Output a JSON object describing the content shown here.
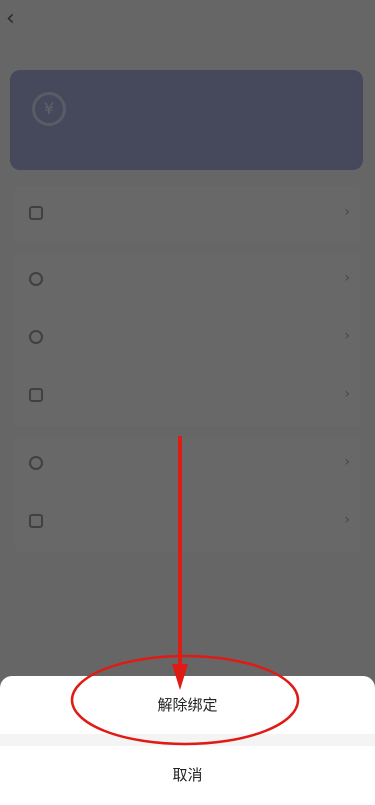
{
  "page": {
    "nav": {
      "back_icon": "chevron-left-icon",
      "title": "",
      "help": ""
    },
    "card": {
      "text": ""
    },
    "groups": [
      {
        "rows": [
          {
            "icon": "card-icon",
            "label": "",
            "value": ""
          }
        ]
      },
      {
        "rows": [
          {
            "icon": "shield-icon",
            "label": "",
            "value": ""
          },
          {
            "icon": "shield-icon",
            "label": "",
            "value": ""
          },
          {
            "icon": "wallet-icon",
            "label": "",
            "value": ""
          }
        ]
      },
      {
        "rows": [
          {
            "icon": "clock-icon",
            "label": "",
            "value": ""
          },
          {
            "icon": "card-icon",
            "label": "",
            "value": ""
          }
        ]
      }
    ]
  },
  "sheet": {
    "unbind_label": "解除绑定",
    "cancel_label": "取消"
  },
  "annotation": {
    "color": "#e01a14"
  }
}
